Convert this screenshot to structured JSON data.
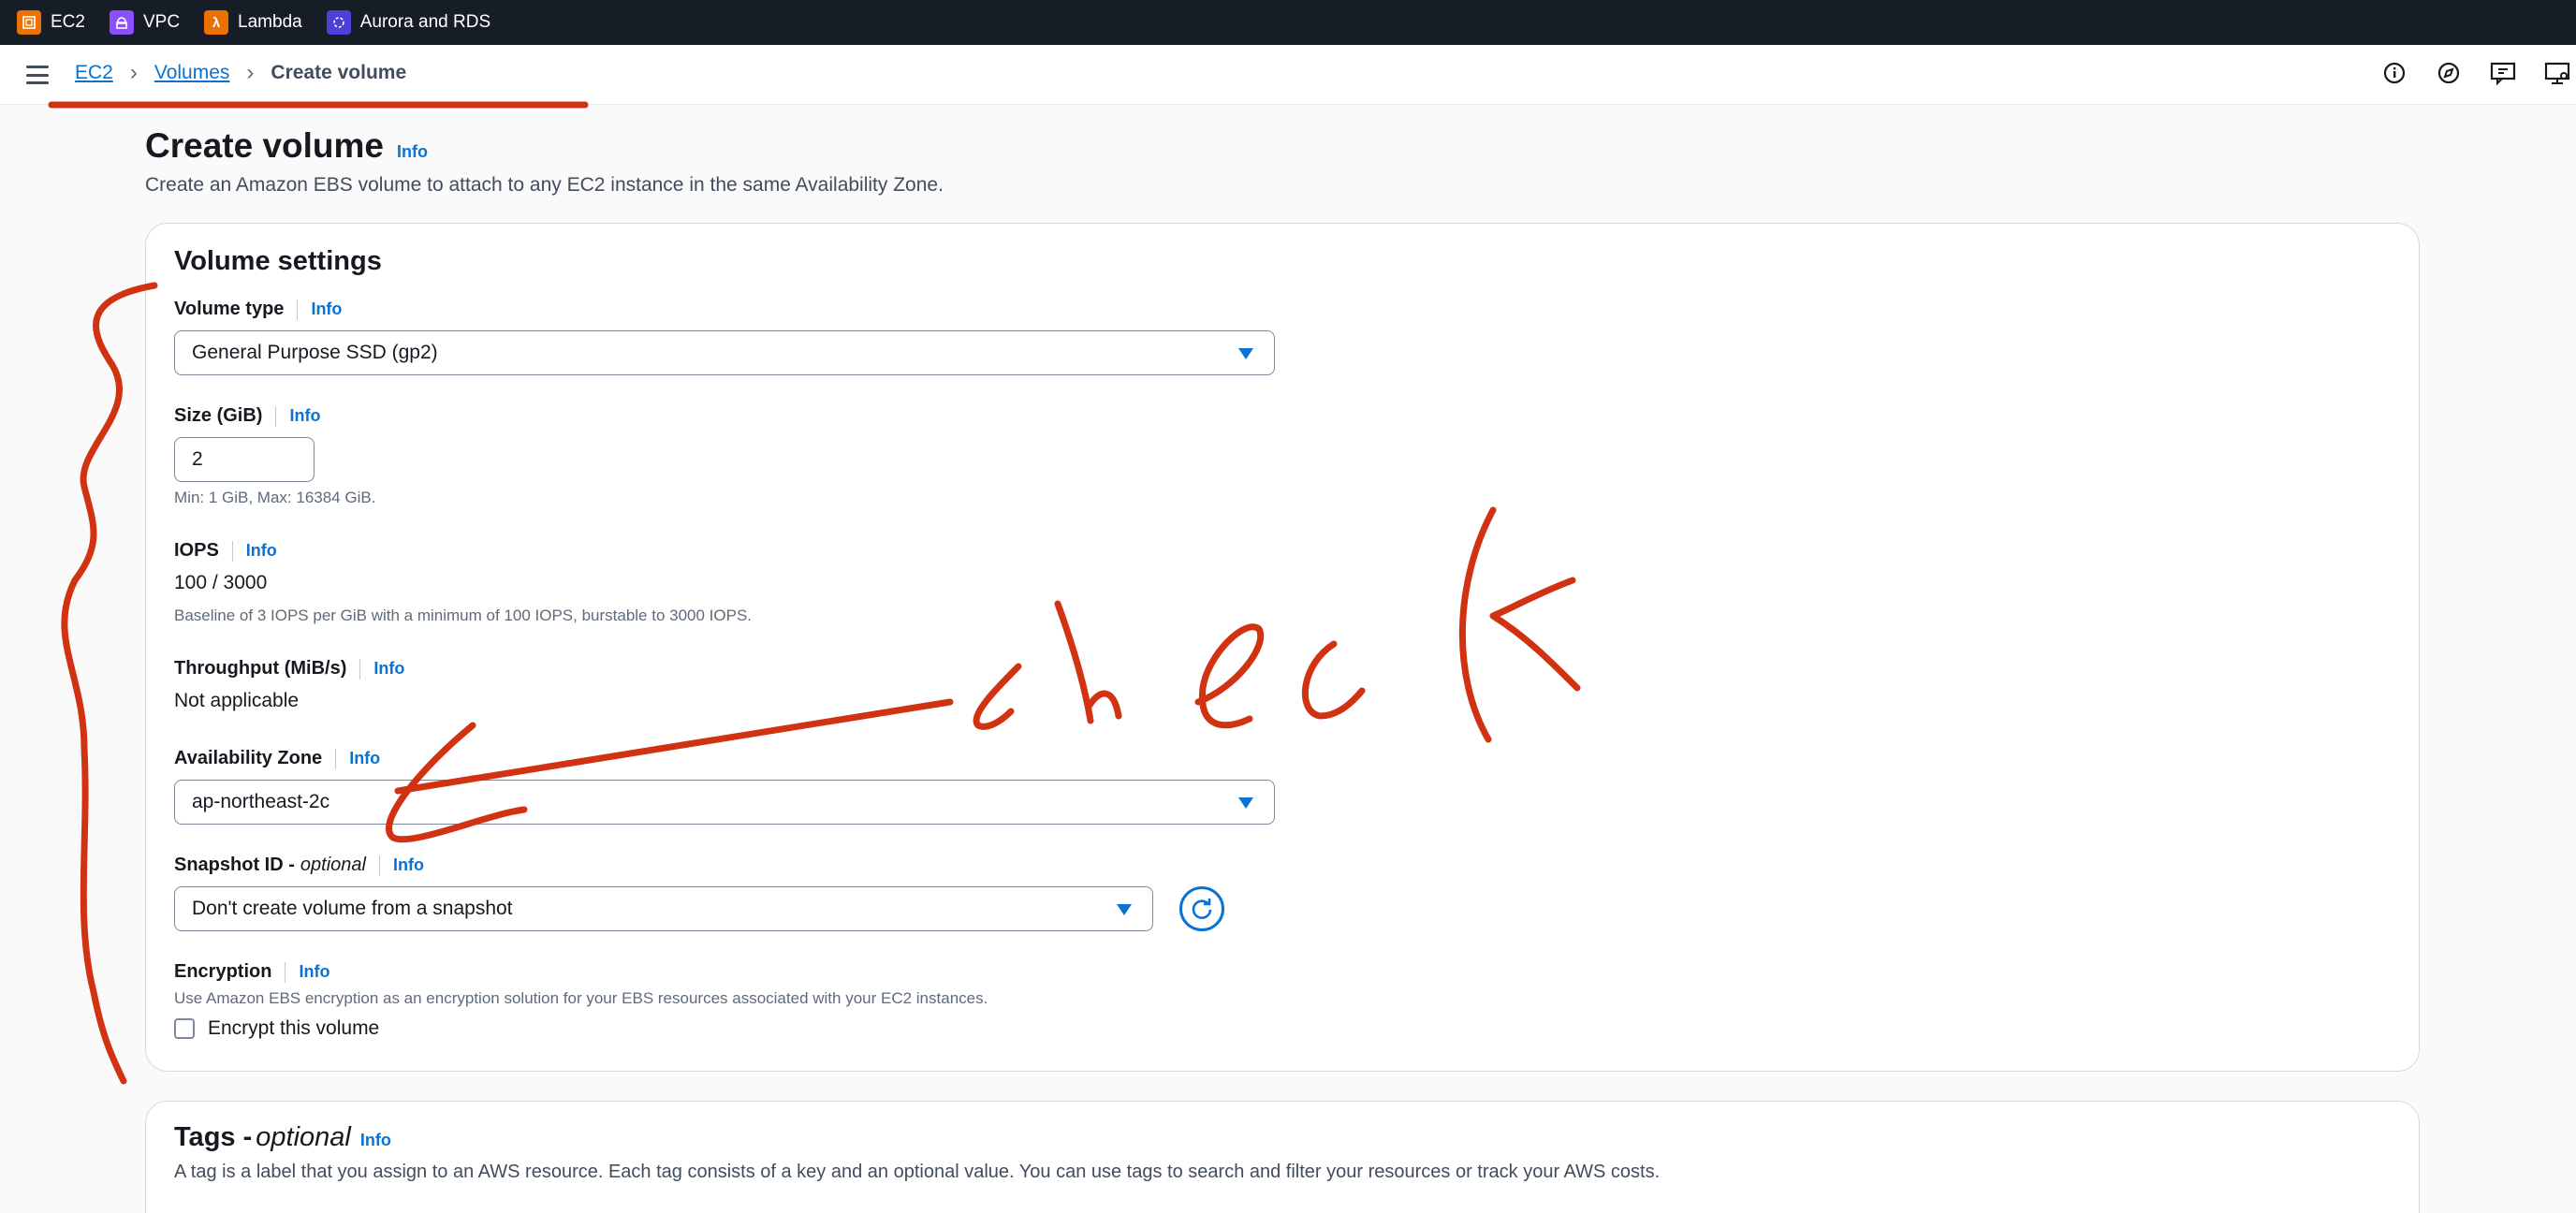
{
  "favorites": [
    {
      "label": "EC2",
      "icon": "ec2-icon",
      "color": "#ed7100"
    },
    {
      "label": "VPC",
      "icon": "vpc-icon",
      "color": "#8c4fff"
    },
    {
      "label": "Lambda",
      "icon": "lambda-icon",
      "color": "#ed7100"
    },
    {
      "label": "Aurora and RDS",
      "icon": "rds-icon",
      "color": "#4e3fd8"
    }
  ],
  "breadcrumb": {
    "items": [
      "EC2",
      "Volumes"
    ],
    "current": "Create volume"
  },
  "header": {
    "title": "Create volume",
    "info": "Info",
    "description": "Create an Amazon EBS volume to attach to any EC2 instance in the same Availability Zone."
  },
  "volume_settings": {
    "title": "Volume settings",
    "volume_type": {
      "label": "Volume type",
      "info": "Info",
      "value": "General Purpose SSD (gp2)"
    },
    "size": {
      "label": "Size (GiB)",
      "info": "Info",
      "value": "2",
      "hint": "Min: 1 GiB, Max: 16384 GiB."
    },
    "iops": {
      "label": "IOPS",
      "info": "Info",
      "value": "100 / 3000",
      "hint": "Baseline of 3 IOPS per GiB with a minimum of 100 IOPS, burstable to 3000 IOPS."
    },
    "throughput": {
      "label": "Throughput (MiB/s)",
      "info": "Info",
      "value": "Not applicable"
    },
    "availability_zone": {
      "label": "Availability Zone",
      "info": "Info",
      "value": "ap-northeast-2c"
    },
    "snapshot": {
      "label": "Snapshot ID - ",
      "label_optional": "optional",
      "info": "Info",
      "value": "Don't create volume from a snapshot"
    },
    "encryption": {
      "label": "Encryption",
      "info": "Info",
      "hint": "Use Amazon EBS encryption as an encryption solution for your EBS resources associated with your EC2 instances.",
      "checkbox_label": "Encrypt this volume",
      "checked": false
    }
  },
  "tags": {
    "title": "Tags - ",
    "title_optional": "optional",
    "info": "Info",
    "description": "A tag is a label that you assign to an AWS resource. Each tag consists of a key and an optional value. You can use tags to search and filter your resources or track your AWS costs."
  },
  "colors": {
    "link": "#0972d3",
    "annotation": "#d13212",
    "topbar": "#161d26"
  }
}
